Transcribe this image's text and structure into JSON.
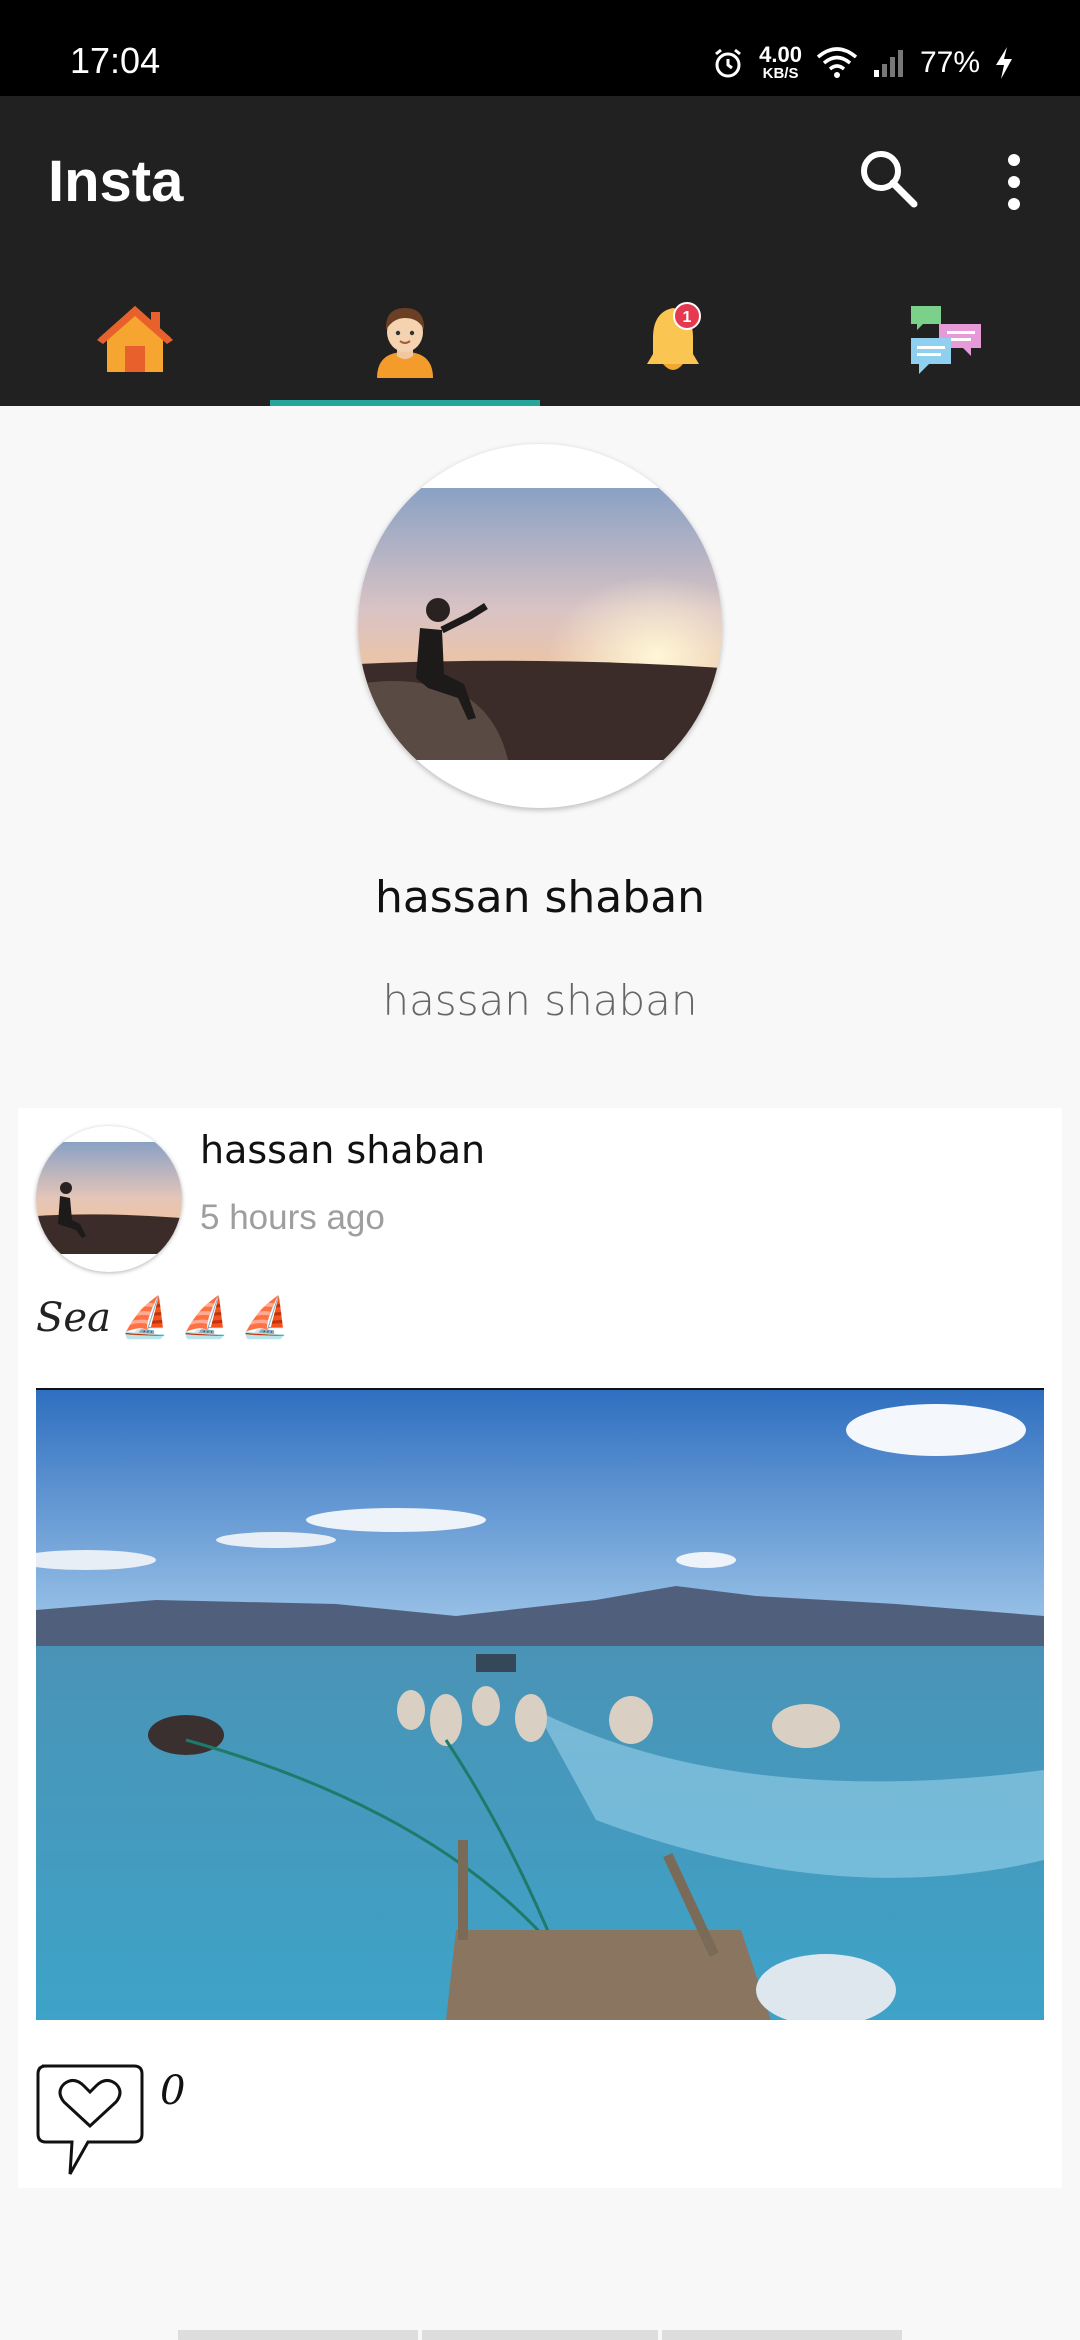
{
  "status_bar": {
    "time": "17:04",
    "net_speed_value": "4.00",
    "net_speed_unit": "KB/S",
    "battery": "77%"
  },
  "app_bar": {
    "title": "Insta",
    "icons": [
      "search-icon",
      "more-vert-icon"
    ]
  },
  "tabs": [
    {
      "icon": "home-icon",
      "selected": false
    },
    {
      "icon": "profile-icon",
      "selected": true
    },
    {
      "icon": "notification-bell-icon",
      "badge": "1",
      "selected": false
    },
    {
      "icon": "chat-icon",
      "selected": false
    }
  ],
  "profile": {
    "name": "hassan shaban",
    "username": "hassan shaban"
  },
  "post": {
    "author": "hassan shaban",
    "time": "5 hours ago",
    "caption": "Sea",
    "caption_emojis": [
      "⛵",
      "⛵",
      "⛵"
    ],
    "likes": "0"
  },
  "colors": {
    "app_bar": "#212121",
    "tab_indicator": "#26a69a",
    "background": "#f8f8f8",
    "badge": "#e53950"
  }
}
